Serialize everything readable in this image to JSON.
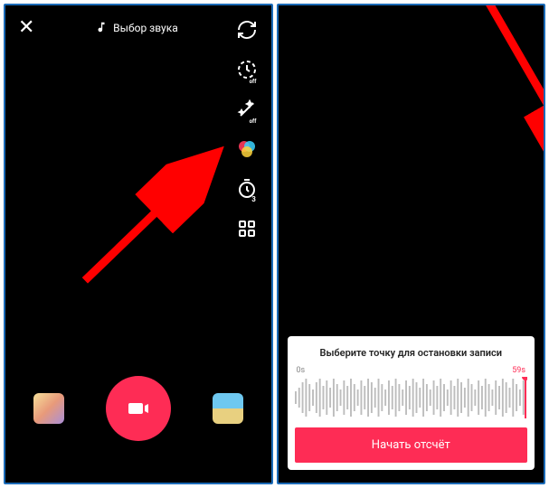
{
  "leftPhone": {
    "soundSelectLabel": "Выбор звука",
    "tools": {
      "flip": "flip-camera-icon",
      "speed": "speed-icon",
      "beauty": "beauty-icon",
      "filters": "filters-icon",
      "timer": "timer-3s-icon",
      "more": "more-grid-icon"
    }
  },
  "rightPhone": {
    "sheetTitle": "Выберите точку для остановки записи",
    "timeStart": "0s",
    "timeEnd": "59s",
    "startButton": "Начать отсчёт"
  }
}
